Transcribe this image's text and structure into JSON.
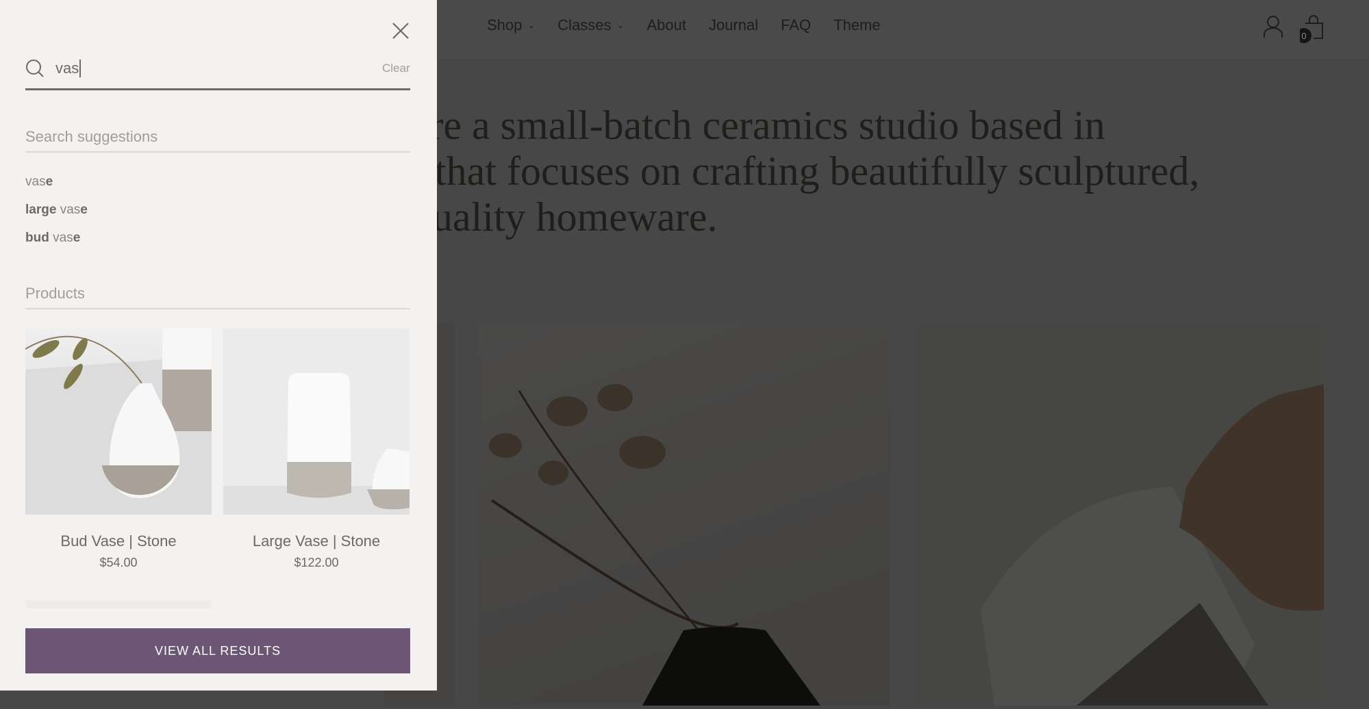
{
  "header": {
    "nav": [
      {
        "label": "Shop",
        "dropdown": true
      },
      {
        "label": "Classes",
        "dropdown": true
      },
      {
        "label": "About"
      },
      {
        "label": "Journal"
      },
      {
        "label": "FAQ"
      },
      {
        "label": "Theme"
      }
    ],
    "cart_count": "0"
  },
  "hero": {
    "text": "We're a small-batch ceramics studio based in [city] that focuses on crafting beautifully sculptured, quality homeware.",
    "line1": "e're a small-batch ceramics studio based in",
    "line2": "that focuses on crafting beautifully sculptured,",
    "line3": "uality homeware."
  },
  "search": {
    "value": "vas",
    "clear_label": "Clear",
    "suggestions_heading": "Search suggestions",
    "suggestions": [
      {
        "bold_prefix": "",
        "match": "vas",
        "suffix": "e"
      },
      {
        "bold_prefix": "large ",
        "match": "vas",
        "suffix": "e"
      },
      {
        "bold_prefix": "bud ",
        "match": "vas",
        "suffix": "e"
      }
    ],
    "products_heading": "Products",
    "products": [
      {
        "title": "Bud Vase | Stone",
        "price": "$54.00"
      },
      {
        "title": "Large Vase | Stone",
        "price": "$122.00"
      }
    ],
    "view_all_label": "VIEW ALL RESULTS"
  },
  "colors": {
    "accent": "#6b5676",
    "panel_bg": "#f3f2f0",
    "text": "#6d6a63"
  }
}
